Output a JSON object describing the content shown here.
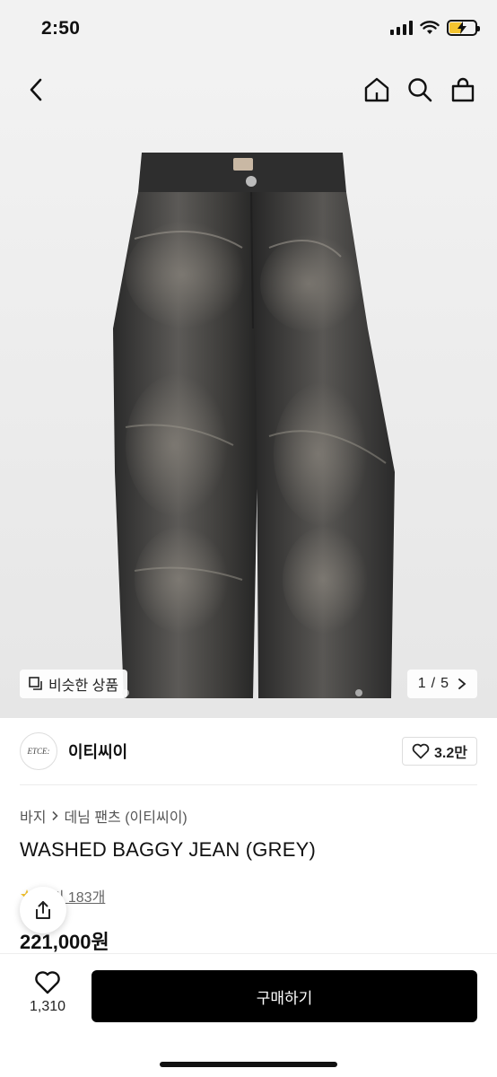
{
  "status": {
    "time": "2:50",
    "battery_percent": 50,
    "battery_color": "#f4c430"
  },
  "nav": {
    "back_icon": "chevron-left-icon",
    "home_icon": "home-icon",
    "search_icon": "search-icon",
    "cart_icon": "shopping-bag-icon"
  },
  "gallery": {
    "similar_label": "비슷한 상품",
    "current": "1",
    "total": "5",
    "separator": "/"
  },
  "brand": {
    "logo_text": "ETCE:",
    "name": "이티씨이",
    "likes": "3.2만"
  },
  "product": {
    "breadcrumb": [
      "바지",
      "데님 팬츠 (이티씨이)"
    ],
    "title": "WASHED BAGGY JEAN (GREY)",
    "review_label": "후기 183개",
    "price": "221,000원"
  },
  "bottom": {
    "like_count": "1,310",
    "buy_label": "구매하기"
  }
}
